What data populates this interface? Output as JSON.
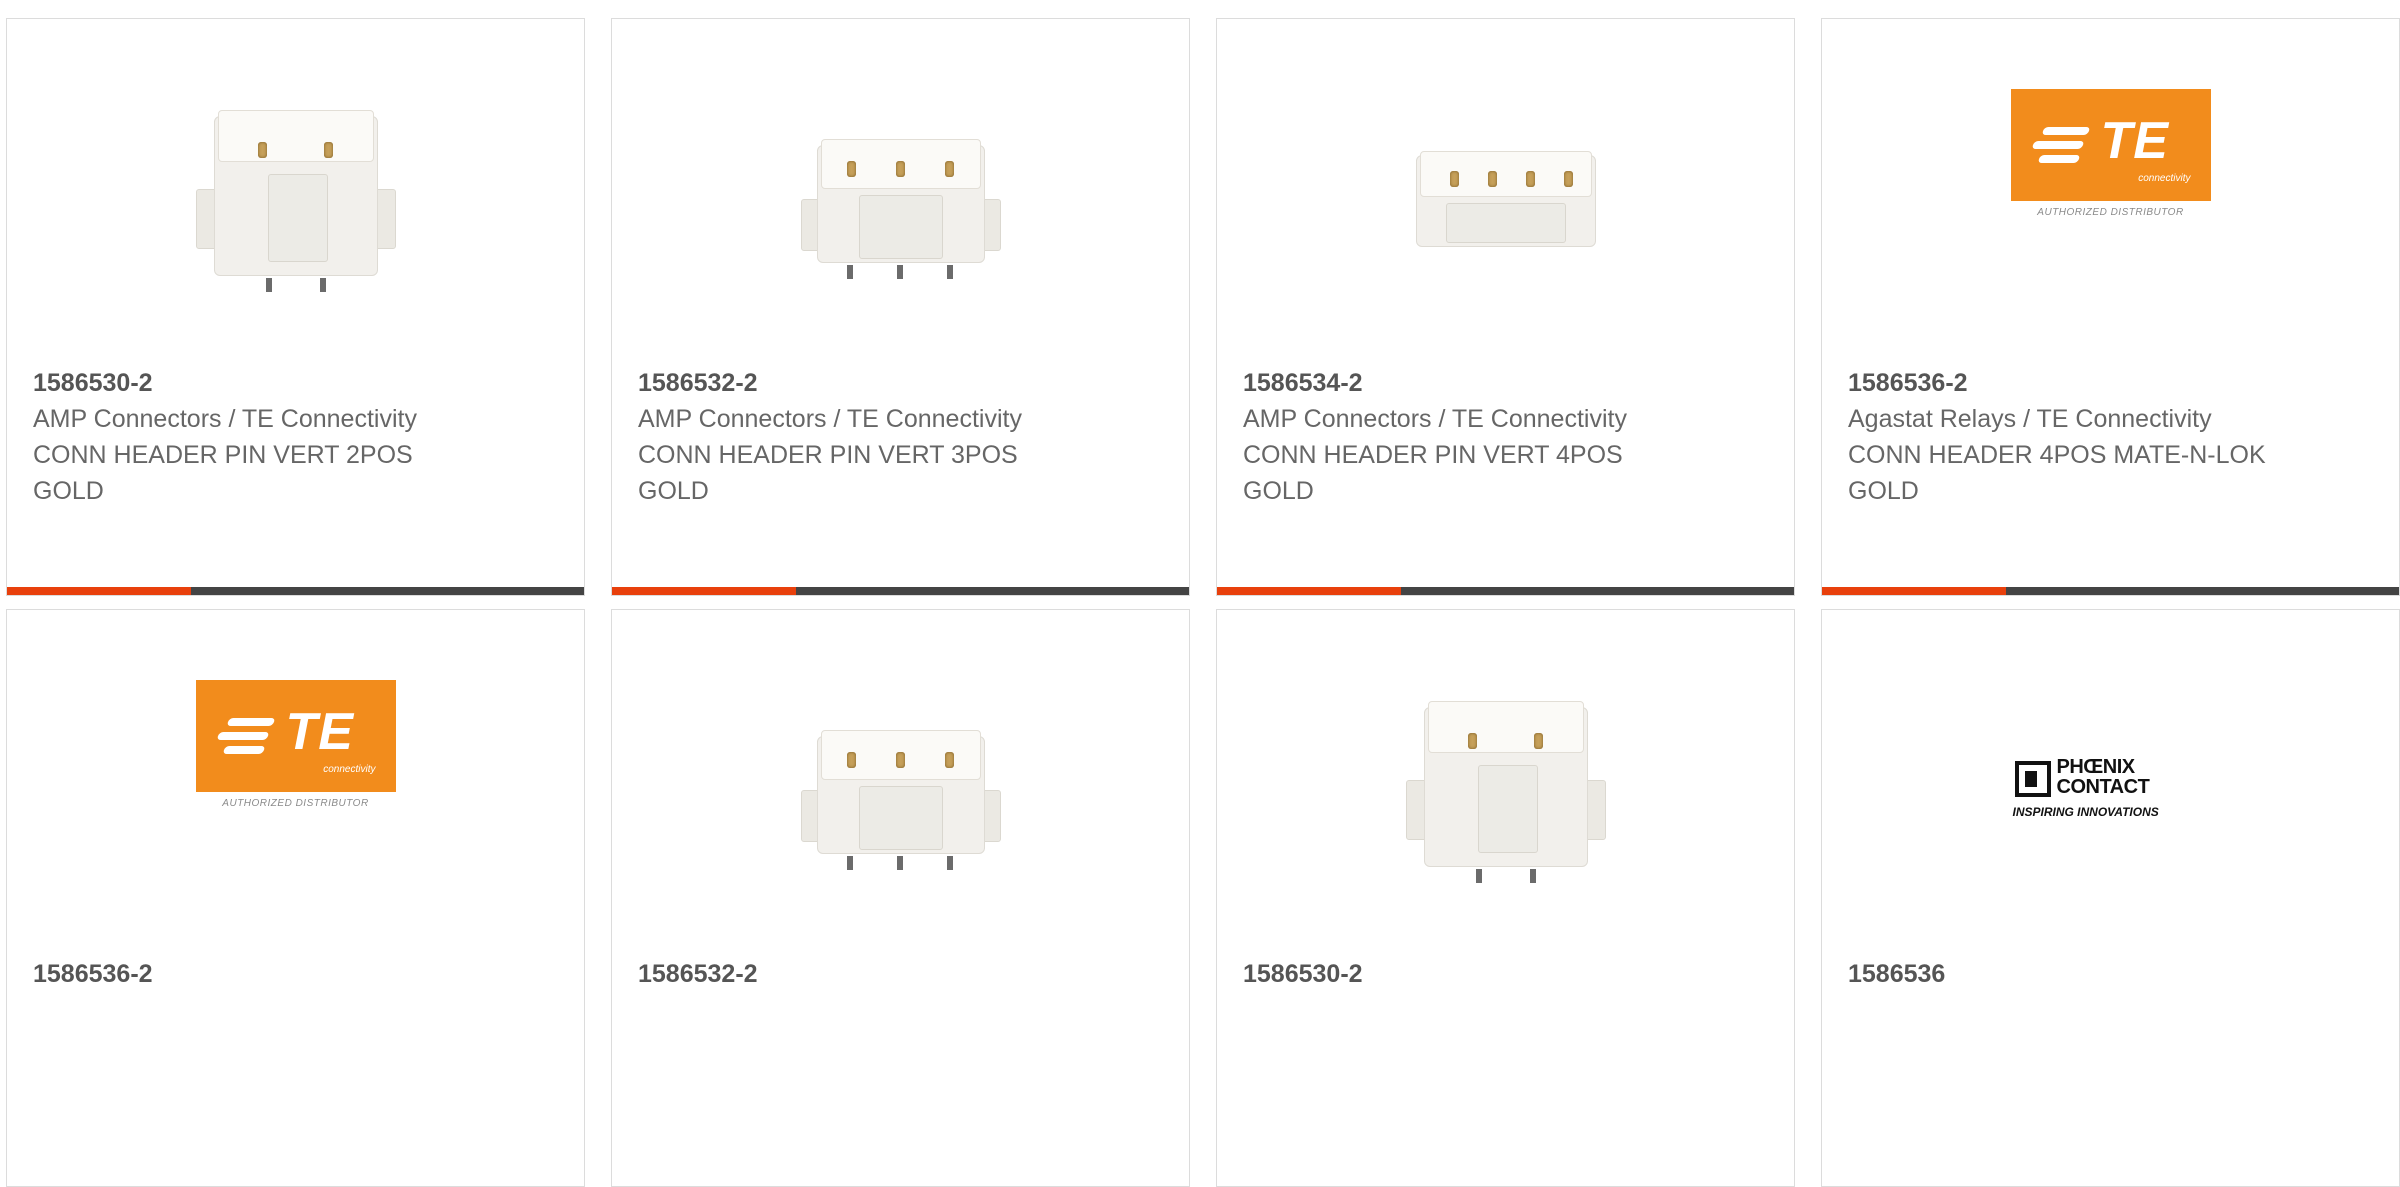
{
  "products": [
    {
      "part_number": "1586530-2",
      "manufacturer": "AMP Connectors / TE Connectivity",
      "description": "CONN HEADER PIN VERT 2POS GOLD",
      "image": "connector-2pos"
    },
    {
      "part_number": "1586532-2",
      "manufacturer": "AMP Connectors / TE Connectivity",
      "description": "CONN HEADER PIN VERT 3POS GOLD",
      "image": "connector-3pos"
    },
    {
      "part_number": "1586534-2",
      "manufacturer": "AMP Connectors / TE Connectivity",
      "description": "CONN HEADER PIN VERT 4POS GOLD",
      "image": "connector-4pos"
    },
    {
      "part_number": "1586536-2",
      "manufacturer": "Agastat Relays / TE Connectivity",
      "description": "CONN HEADER 4POS MATE-N-LOK GOLD",
      "image": "te-logo"
    },
    {
      "part_number": "1586536-2",
      "image": "te-logo"
    },
    {
      "part_number": "1586532-2",
      "image": "connector-3pos"
    },
    {
      "part_number": "1586530-2",
      "image": "connector-2pos"
    },
    {
      "part_number": "1586536",
      "image": "phoenix-contact-logo"
    }
  ],
  "logos": {
    "te_letters": "TE",
    "te_sub": "connectivity",
    "te_authorized": "AUTHORIZED DISTRIBUTOR",
    "phoenix_line1": "PHŒNIX",
    "phoenix_line2": "CONTACT",
    "phoenix_tag": "INSPIRING INNOVATIONS"
  },
  "colors": {
    "accent_orange": "#e8400c",
    "bar_dark": "#444444",
    "te_orange": "#f28c1c"
  }
}
